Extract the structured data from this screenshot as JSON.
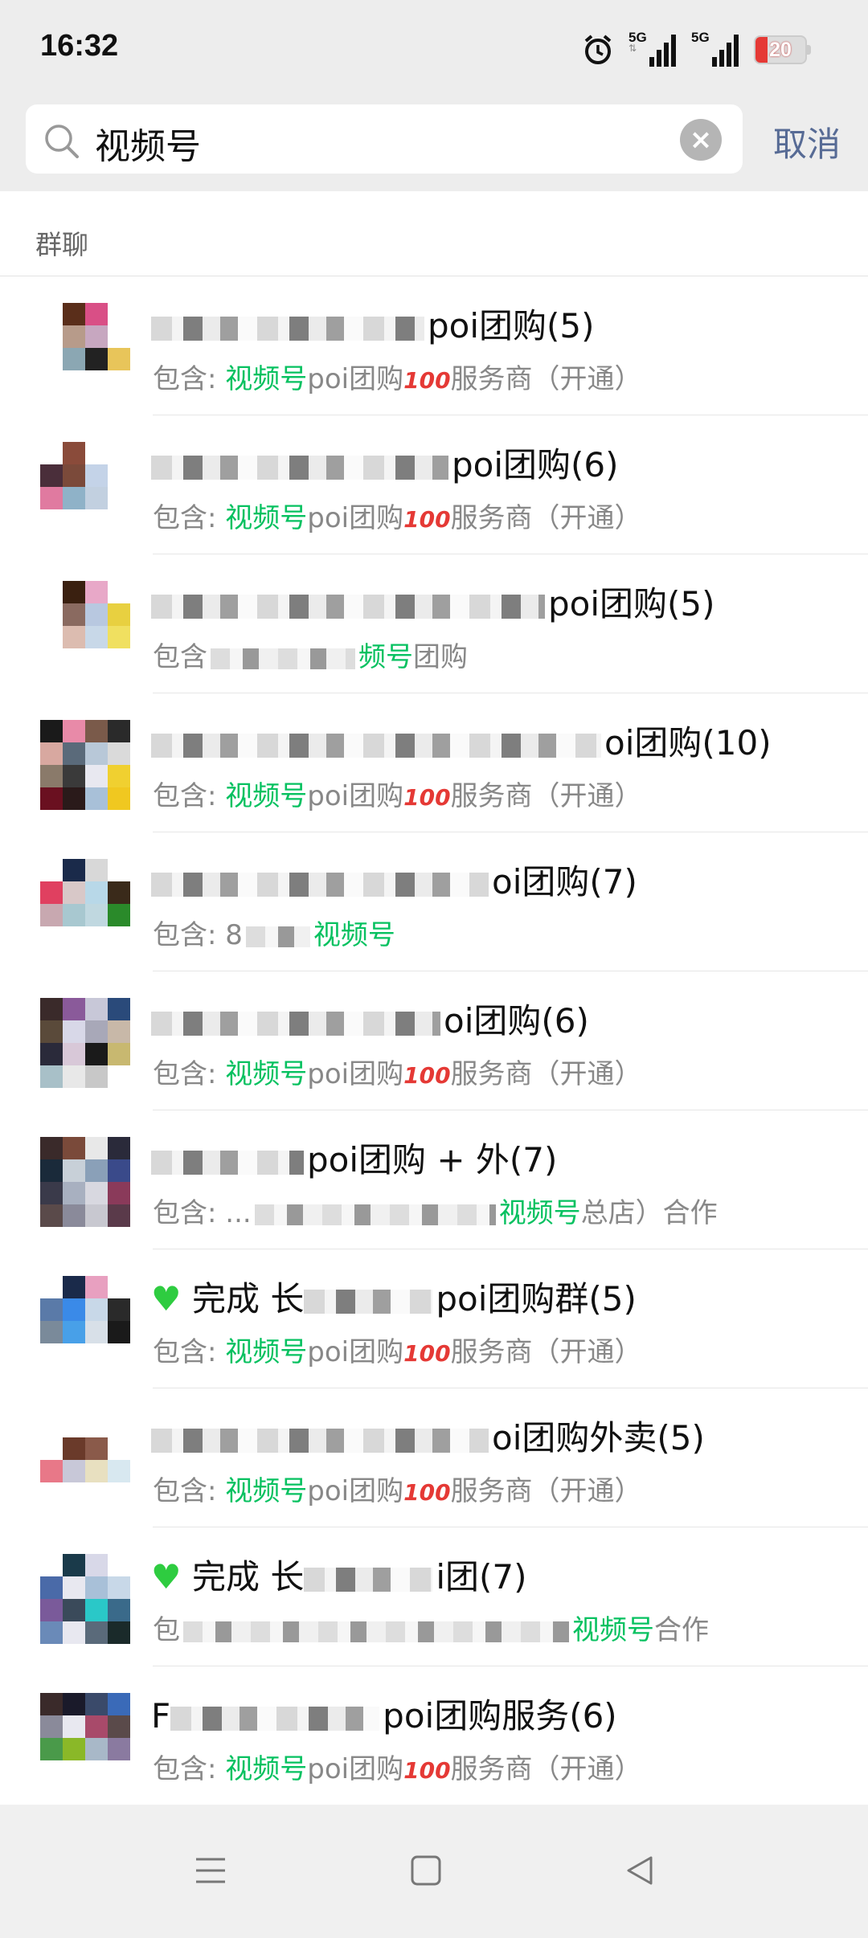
{
  "status": {
    "time": "16:32",
    "network1": "5G",
    "network2": "5G",
    "battery": "20",
    "battery_level": 0.2
  },
  "search": {
    "value": "视频号",
    "cancel_label": "取消",
    "icon": "search-icon",
    "clear_icon": "clear-icon"
  },
  "section": {
    "title": "群聊"
  },
  "colors": {
    "highlight": "#07c160",
    "link": "#576b95"
  },
  "results": [
    {
      "title_suffix": "poi团购(5)",
      "sub_prefix": "包含: ",
      "sub_match": "视频号",
      "sub_rest": "poi团购",
      "sub_tail": "服务商（开通）",
      "avatar": [
        "#fff",
        "#5a2e1a",
        "#d94f86",
        "#fff",
        "#fff",
        "#b79b8a",
        "#c7a7c0",
        "#fff",
        "#fff",
        "#8ba7b3",
        "#222",
        "#e8c55a",
        "#fff",
        "#fff",
        "#fff",
        "#fff"
      ]
    },
    {
      "title_suffix": "poi团购(6)",
      "sub_prefix": "包含: ",
      "sub_match": "视频号",
      "sub_rest": "poi团购",
      "sub_tail": "服务商（开通）",
      "avatar": [
        "#fff",
        "#8a4b3a",
        "#fff",
        "#fff",
        "#4a2e3a",
        "#7b4a3a",
        "#c4d3e8",
        "#fff",
        "#e07aa0",
        "#8fb2c8",
        "#c2d0e0",
        "#fff",
        "#fff",
        "#fff",
        "#fff",
        "#fff"
      ]
    },
    {
      "title_suffix": "poi团购(5)",
      "sub_prefix": "包含",
      "sub_match": "频号",
      "sub_rest": "团购",
      "sub_tail": "",
      "avatar": [
        "#fff",
        "#3a2010",
        "#e8a8c8",
        "#fff",
        "#fff",
        "#8a6a60",
        "#b8c8e0",
        "#e8d040",
        "#fff",
        "#dcbcb0",
        "#c8d8e8",
        "#f0e060",
        "#fff",
        "#fff",
        "#fff",
        "#fff"
      ]
    },
    {
      "title_suffix": "oi团购(10)",
      "sub_prefix": "包含: ",
      "sub_match": "视频号",
      "sub_rest": "poi团购",
      "sub_tail": "服务商（开通）",
      "avatar": [
        "#1a1a1a",
        "#e88aa8",
        "#7a5a4a",
        "#2a2a2a",
        "#d8a8a0",
        "#5a6a7a",
        "#b8c8d8",
        "#dadada",
        "#8a7a6a",
        "#3a3a3a",
        "#e8e8f0",
        "#f0d030",
        "#6a1020",
        "#2a1a1a",
        "#a8c0d8",
        "#f0c820"
      ]
    },
    {
      "title_suffix": "oi团购(7)",
      "sub_prefix": "包含: 8",
      "sub_match": "视频号",
      "sub_rest": "",
      "sub_tail": "",
      "avatar": [
        "#fff",
        "#1a2a4a",
        "#d8d8d8",
        "#fff",
        "#e04060",
        "#d8c8c8",
        "#b8d8e8",
        "#3a2a1a",
        "#c8a8b0",
        "#a8c8d0",
        "#c0d8e0",
        "#2a8a2a",
        "#fff",
        "#fff",
        "#fff",
        "#fff"
      ]
    },
    {
      "title_suffix": "oi团购(6)",
      "sub_prefix": "包含: ",
      "sub_match": "视频号",
      "sub_rest": "poi团购",
      "sub_tail": "服务商（开通）",
      "avatar": [
        "#3a2a2a",
        "#8a5a9a",
        "#c8c8d8",
        "#2a4a7a",
        "#5a4a3a",
        "#d8d8e8",
        "#a8a8b8",
        "#c8b8a8",
        "#2a2a3a",
        "#d8c8d8",
        "#1a1a1a",
        "#c8b870",
        "#a8c0c8",
        "#e8e8e8",
        "#c8c8c8",
        "#fff"
      ]
    },
    {
      "title_suffix": "poi团购 + 外(7)",
      "sub_prefix": "包含: ...",
      "sub_match": "视频号",
      "sub_rest": "总店）合作",
      "sub_tail": "",
      "avatar": [
        "#3a2a2a",
        "#7a4a3a",
        "#e8e8e8",
        "#2a2a3a",
        "#1a2a3a",
        "#c8d0d8",
        "#8aa0b8",
        "#3a4a8a",
        "#3a3a4a",
        "#a8b0c0",
        "#d8d8e0",
        "#8a3a5a",
        "#5a4a4a",
        "#8a8a9a",
        "#c8c8d0",
        "#5a3a4a"
      ]
    },
    {
      "title_prefix": "完成 长",
      "title_suffix": "poi团购群(5)",
      "sub_prefix": "包含: ",
      "sub_match": "视频号",
      "sub_rest": "poi团购",
      "sub_tail": "服务商（开通）",
      "avatar": [
        "#fff",
        "#1a2a4a",
        "#e8a0c0",
        "#fff",
        "#5a7aa8",
        "#3a8ae8",
        "#c8d8e8",
        "#2a2a2a",
        "#7a8a9a",
        "#48a0e8",
        "#d8e0e8",
        "#1a1a1a",
        "#fff",
        "#fff",
        "#fff",
        "#fff"
      ]
    },
    {
      "title_suffix": "oi团购外卖(5)",
      "sub_prefix": "包含: ",
      "sub_match": "视频号",
      "sub_rest": "poi团购",
      "sub_tail": "服务商（开通）",
      "avatar": [
        "#fff",
        "#fff",
        "#fff",
        "#fff",
        "#fff",
        "#6a3a2a",
        "#8a5a4a",
        "#fff",
        "#e87888",
        "#c8c8d8",
        "#e8e0c0",
        "#d8e8f0",
        "#fff",
        "#fff",
        "#fff",
        "#fff"
      ]
    },
    {
      "title_prefix": "完成 长",
      "title_suffix": "i团(7)",
      "sub_prefix": "包",
      "sub_match": "视频号",
      "sub_rest": "合作",
      "sub_tail": "",
      "avatar": [
        "#fff",
        "#1a3a4a",
        "#d8d8e8",
        "#fff",
        "#4a6aa8",
        "#e8e8f0",
        "#a8c0d8",
        "#c8d8e8",
        "#7a5a9a",
        "#3a4a5a",
        "#2ac8c8",
        "#3a6a8a",
        "#6a8ab8",
        "#e8e8f0",
        "#5a6a7a",
        "#1a2a2a"
      ]
    },
    {
      "title_prefix": "F",
      "title_suffix": "poi团购服务(6)",
      "sub_prefix": "包含: ",
      "sub_match": "视频号",
      "sub_rest": "poi团购",
      "sub_tail": "服务商（开通）",
      "avatar": [
        "#3a2a2a",
        "#1a1a2a",
        "#3a4a6a",
        "#3a6ab8",
        "#8a8a9a",
        "#e8e8f0",
        "#a84a6a",
        "#5a4a4a",
        "#4a9a4a",
        "#8ab828",
        "#a8b8c8",
        "#8a7aa0",
        "#fff",
        "#fff",
        "#fff",
        "#fff"
      ]
    }
  ],
  "nav": {
    "menu_icon": "menu-icon",
    "home_icon": "home-icon",
    "back_icon": "back-icon"
  }
}
